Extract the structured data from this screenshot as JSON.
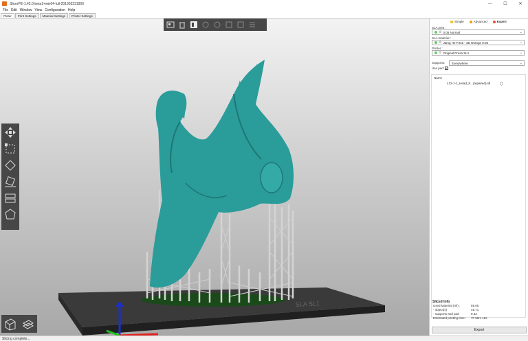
{
  "window": {
    "title": "SlicerPE-1.42.0-beta1+win64-full-201903231906",
    "minimize": "—",
    "maximize": "☐",
    "close": "✕"
  },
  "menu": [
    "File",
    "Edit",
    "Window",
    "View",
    "Configuration",
    "Help"
  ],
  "tabs": [
    "Plater",
    "Print Settings",
    "Material Settings",
    "Printer Settings"
  ],
  "top_toolbar_icons": [
    "add-icon",
    "delete-icon",
    "arrange-icon",
    "copy-icon",
    "paste-icon",
    "increase-icon",
    "decrease-icon",
    "split-icon",
    "layers-icon"
  ],
  "left_toolbar_icons": [
    "move-icon",
    "scale-icon",
    "rotate-icon",
    "place-on-face-icon",
    "cut-icon",
    "sla-support-points-icon"
  ],
  "bed_label": "SLA SL1",
  "status": "Slicing complete...",
  "sidebar": {
    "modes": [
      {
        "label": "Simple",
        "color": "#f1c40f"
      },
      {
        "label": "Advanced",
        "color": "#f39c12"
      },
      {
        "label": "Expert",
        "color": "#e74c3c"
      }
    ],
    "sla_print_label": "SLA print :",
    "sla_print_value": "0.05 Normal",
    "sla_material_label": "SLA material :",
    "sla_material_value": "Jamg He PJ15 - 3D Orange 0.05",
    "printer_label": "Printer :",
    "printer_value": "Original Prusa SL1",
    "supports_label": "Supports:",
    "supports_value": "Everywhere",
    "pad_label": "Use pad:",
    "pad_checked": "✓",
    "list_header": "Name",
    "objects": [
      {
        "name": "L12-1-1_Head_S...(repaired).stl"
      }
    ],
    "sliced_info": {
      "title": "Sliced Info",
      "rows": [
        {
          "label": "Used Material (ml) :",
          "value": "59.05"
        },
        {
          "label": "- object(s)",
          "value": "49.71"
        },
        {
          "label": "- supports and pad",
          "value": "9.32"
        },
        {
          "label": "Estimated printing time :",
          "value": "7h 55m 16s"
        }
      ]
    },
    "export_label": "Export"
  }
}
